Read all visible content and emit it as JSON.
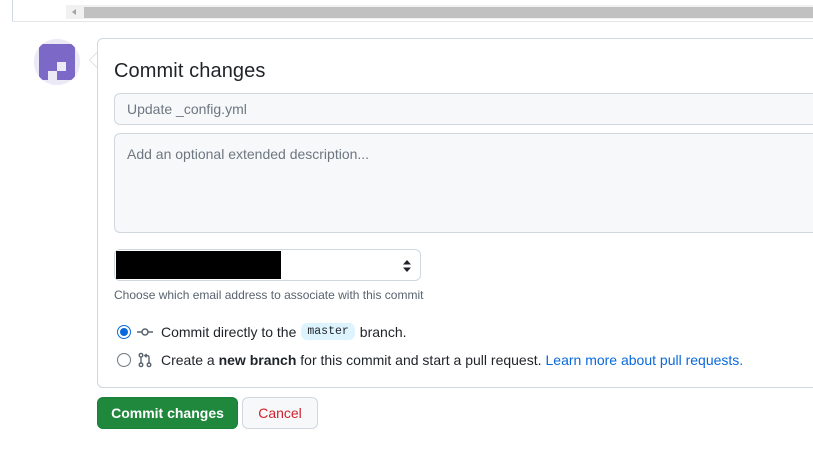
{
  "scrollbar": {
    "left_arrow_icon": "chevron-left-icon"
  },
  "avatar": {
    "icon": "identicon-purple"
  },
  "panel": {
    "title": "Commit changes",
    "summary": {
      "placeholder": "Update _config.yml",
      "value": ""
    },
    "description": {
      "placeholder": "Add an optional extended description...",
      "value": ""
    },
    "email_select": {
      "selected_value": "[redacted]",
      "hint": "Choose which email address to associate with this commit"
    },
    "options": {
      "direct": {
        "checked": true,
        "text_before": "Commit directly to the",
        "branch": "master",
        "text_after": "branch."
      },
      "new_branch": {
        "checked": false,
        "text_before": "Create a",
        "bold": "new branch",
        "text_after": "for this commit and start a pull request.",
        "link": "Learn more about pull requests."
      }
    }
  },
  "buttons": {
    "commit": "Commit changes",
    "cancel": "Cancel"
  },
  "colors": {
    "accent": "#0969da",
    "commit_green": "#1f883d",
    "cancel_red": "#cf222e",
    "avatar_purple": "#7b68c7"
  }
}
